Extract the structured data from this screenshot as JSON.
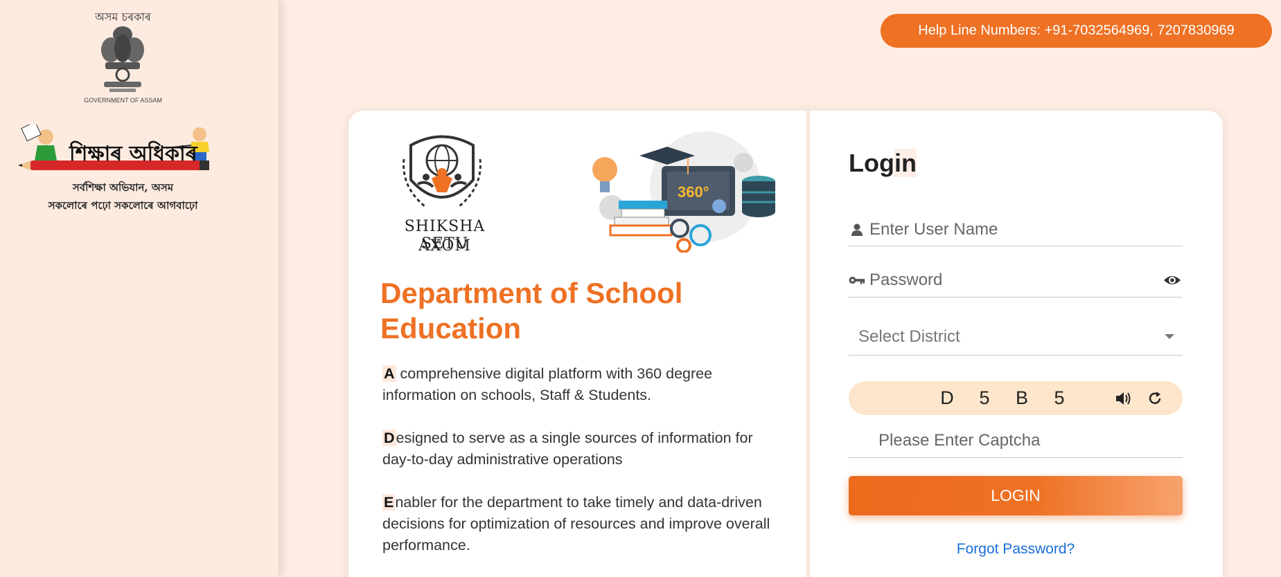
{
  "sidebar": {
    "gov_heading": "অসম চৰকাৰ",
    "gov_caption": "GOVERNMENT OF ASSAM",
    "sa_title": "শিক্ষাৰ অধিকাৰ",
    "sa_line1": "সৰ্বশিক্ষা অভিযান, অসম",
    "sa_line2": "সকলোৰে পঢ়ো সকলোৰে আগবাঢ়ো"
  },
  "header": {
    "helpline": "Help Line Numbers: +91-7032564969, 7207830969"
  },
  "info": {
    "brand_line1": "SHIKSHA SETU",
    "brand_line2": "AXOM",
    "illustration_badge": "360°",
    "title": "Department of School Education",
    "paragraphs": [
      {
        "first": "A",
        "rest": " comprehensive digital platform with 360 degree information on schools, Staff & Students."
      },
      {
        "first": "D",
        "rest": "esigned to serve as a single sources of information for day-to-day administrative operations"
      },
      {
        "first": "E",
        "rest": "nabler for the department to take timely and data-driven decisions for optimization of resources and improve overall performance."
      }
    ]
  },
  "login": {
    "title_start": "Log",
    "title_end": "in",
    "username_placeholder": "Enter User Name",
    "password_placeholder": "Password",
    "district_placeholder": "Select District",
    "captcha_chars": [
      "D",
      "5",
      "B",
      "5"
    ],
    "captcha_placeholder": "Please Enter Captcha",
    "submit_label": "LOGIN",
    "forgot_label": "Forgot Password?"
  },
  "colors": {
    "accent": "#ee7124",
    "background": "#fdede3",
    "link": "#1a6fd6",
    "captcha_bg": "#fde6cc"
  },
  "icons": {
    "username": "user-icon",
    "password": "key-icon",
    "visibility": "eye-icon",
    "dropdown": "caret-down-icon",
    "audio": "speaker-icon",
    "refresh": "refresh-icon"
  }
}
